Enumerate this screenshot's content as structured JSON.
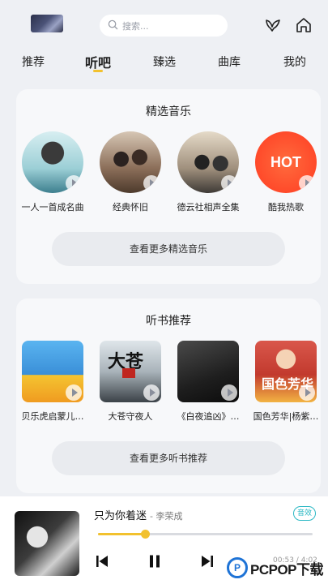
{
  "header": {
    "search_placeholder": "搜索..."
  },
  "tabs": [
    {
      "label": "推荐",
      "active": false
    },
    {
      "label": "听吧",
      "active": true
    },
    {
      "label": "臻选",
      "active": false
    },
    {
      "label": "曲库",
      "active": false
    },
    {
      "label": "我的",
      "active": false
    }
  ],
  "music_section": {
    "title": "精选音乐",
    "items": [
      {
        "label": "一人一首成名曲"
      },
      {
        "label": "经典怀旧"
      },
      {
        "label": "德云社相声全集"
      },
      {
        "label": "酷我热歌",
        "badge": "HOT"
      }
    ],
    "more_label": "查看更多精选音乐"
  },
  "books_section": {
    "title": "听书推荐",
    "items": [
      {
        "label": "贝乐虎启蒙儿…"
      },
      {
        "label": "大苍守夜人",
        "cover_text": "大苍"
      },
      {
        "label": "《白夜追凶》…"
      },
      {
        "label": "国色芳华|杨紫…",
        "cover_text": "国色芳华"
      }
    ],
    "more_label": "查看更多听书推荐"
  },
  "player": {
    "title": "只为你着迷",
    "artist": "- 李荣成",
    "quality": "音效",
    "progress": 0.22,
    "time": "00:53 / 4:02"
  },
  "watermark": {
    "logo": "P",
    "text": "PCPOP下载"
  },
  "colors": {
    "accent": "#f2c12e",
    "background": "#eef0f4",
    "card": "#f7f8fa",
    "quality": "#2bb8c4"
  }
}
